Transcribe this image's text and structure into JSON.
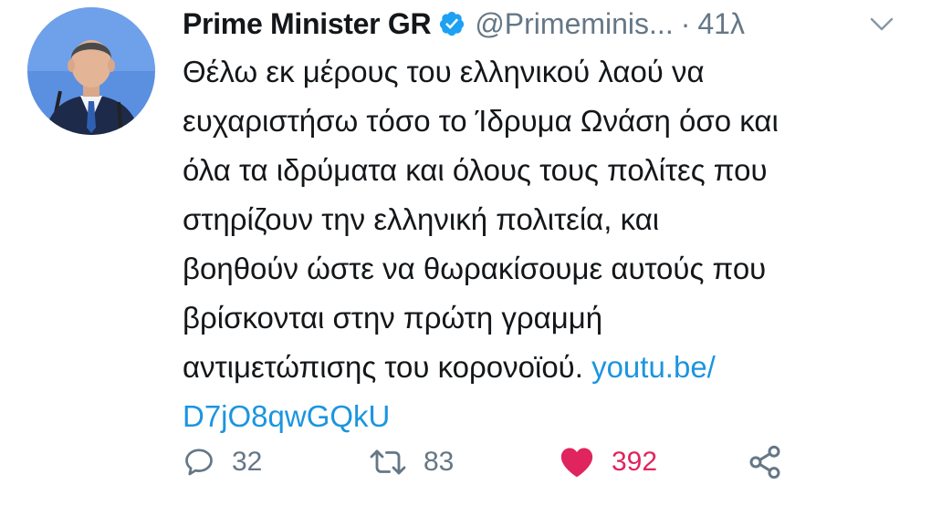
{
  "tweet": {
    "display_name": "Prime Minister GR",
    "handle": "@Primeminis...",
    "separator": "·",
    "time": "41λ",
    "verified": true,
    "body_lines": [
      "Θέλω εκ μέρους του ελληνικού λαού να",
      "ευχαριστήσω τόσο το Ίδρυμα Ωνάση όσο και",
      "όλα τα ιδρύματα και όλους τους πολίτες που",
      "στηρίζουν την ελληνική πολιτεία, και",
      "βοηθούν ώστε να θωρακίσουμε αυτούς που",
      "βρίσκονται στην πρώτη γραμμή",
      "αντιμετώπισης του κορονοϊού."
    ],
    "link_part1": "youtu.be/",
    "link_part2": "D7jO8qwGQkU",
    "replies": "32",
    "retweets": "83",
    "likes": "392"
  },
  "colors": {
    "link": "#1b95e0",
    "secondary_text": "#657786",
    "like": "#e0245e",
    "verified": "#1da1f2"
  },
  "icons": {
    "verified": "verified-badge-icon",
    "menu": "chevron-down-icon",
    "reply": "speech-bubble-icon",
    "retweet": "retweet-arrows-icon",
    "like": "filled-heart-icon",
    "share": "share-nodes-icon"
  }
}
